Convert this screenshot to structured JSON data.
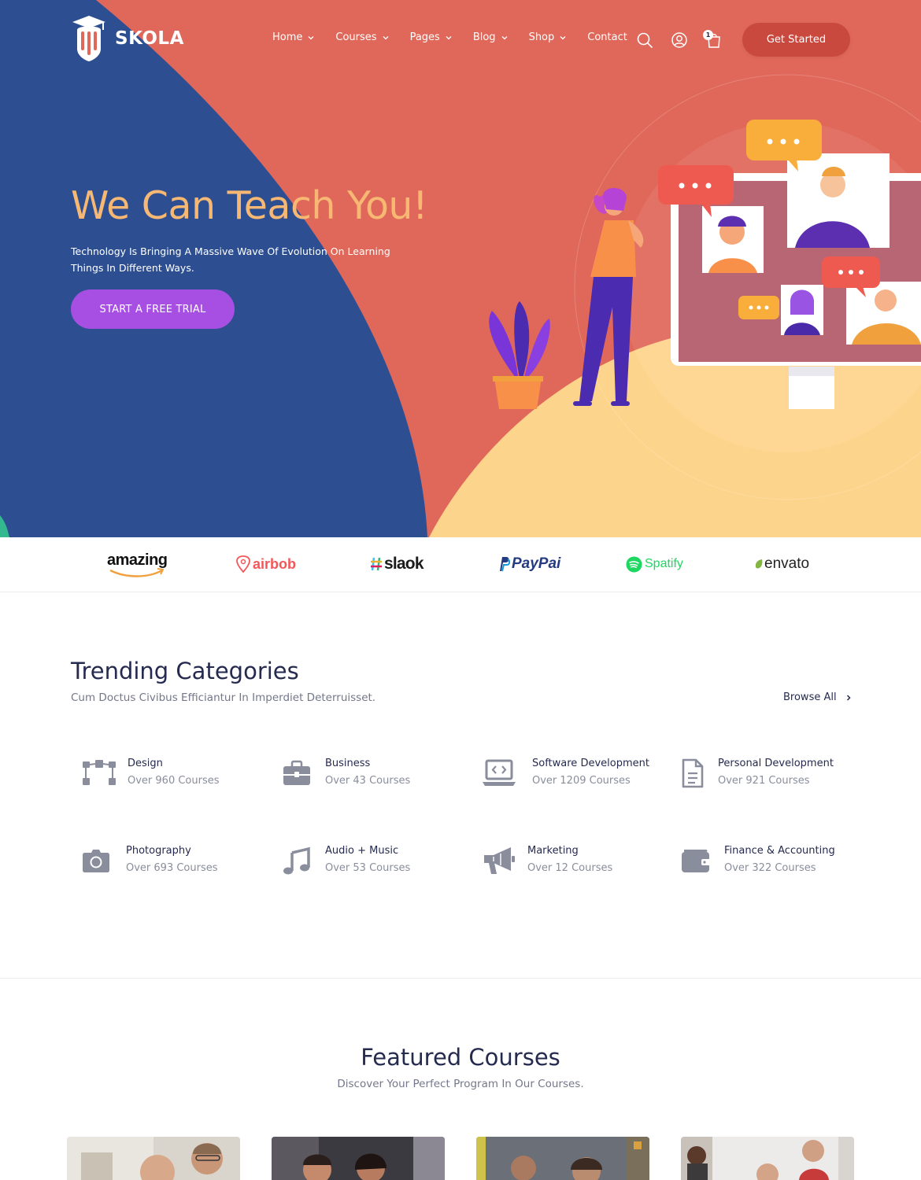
{
  "brand": {
    "name": "SKOLA"
  },
  "nav": {
    "items": [
      {
        "label": "Home",
        "dropdown": true
      },
      {
        "label": "Courses",
        "dropdown": true
      },
      {
        "label": "Pages",
        "dropdown": true
      },
      {
        "label": "Blog",
        "dropdown": true
      },
      {
        "label": "Shop",
        "dropdown": true
      },
      {
        "label": "Contact",
        "dropdown": false
      }
    ],
    "icons": [
      "search-icon",
      "user-icon",
      "cart-icon"
    ],
    "cart_count": "1",
    "cta": "Get Started"
  },
  "hero": {
    "title": "We Can Teach You!",
    "subtitle": "Technology Is Bringing A Massive Wave Of Evolution On Learning Things In Different Ways.",
    "cta": "START A FREE TRIAL"
  },
  "partners": [
    "amazing",
    "airbob",
    "slaok",
    "PayPai",
    "Spatify",
    "envato"
  ],
  "trending": {
    "title": "Trending Categories",
    "subtitle": "Cum Doctus Civibus Efficiantur In Imperdiet Deterruisset.",
    "browse_all": "Browse All",
    "categories": [
      {
        "name": "Design",
        "count": "Over 960 Courses",
        "icon": "design-icon"
      },
      {
        "name": "Business",
        "count": "Over 43 Courses",
        "icon": "briefcase-icon"
      },
      {
        "name": "Software Development",
        "count": "Over 1209 Courses",
        "icon": "laptop-code-icon"
      },
      {
        "name": "Personal Development",
        "count": "Over 921 Courses",
        "icon": "document-icon"
      },
      {
        "name": "Photography",
        "count": "Over 693 Courses",
        "icon": "camera-icon"
      },
      {
        "name": "Audio + Music",
        "count": "Over 53 Courses",
        "icon": "music-note-icon"
      },
      {
        "name": "Marketing",
        "count": "Over 12 Courses",
        "icon": "megaphone-icon"
      },
      {
        "name": "Finance & Accounting",
        "count": "Over 322 Courses",
        "icon": "wallet-icon"
      }
    ]
  },
  "featured": {
    "title": "Featured Courses",
    "subtitle": "Discover Your Perfect Program In Our Courses."
  },
  "colors": {
    "hero_coral": "#e0685a",
    "hero_blue": "#2d4f92",
    "hero_peach": "#fdd48b",
    "accent_purple": "#a64fe2",
    "title_orange": "#f6b873",
    "text_dark": "#252a4f"
  }
}
